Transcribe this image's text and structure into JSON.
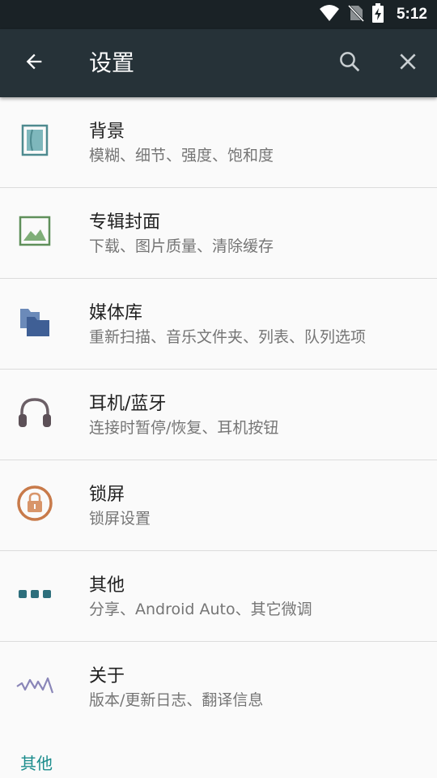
{
  "status_bar": {
    "time": "5:12",
    "icons": [
      "wifi-icon",
      "no-sim-icon",
      "battery-charging-icon"
    ]
  },
  "app_bar": {
    "title": "设置",
    "back_icon": "arrow-back-icon",
    "search_icon": "search-icon",
    "close_icon": "close-icon"
  },
  "settings": [
    {
      "title": "背景",
      "subtitle": "模糊、细节、强度、饱和度",
      "icon": "background-icon"
    },
    {
      "title": "专辑封面",
      "subtitle": "下载、图片质量、清除缓存",
      "icon": "image-icon"
    },
    {
      "title": "媒体库",
      "subtitle": "重新扫描、音乐文件夹、列表、队列选项",
      "icon": "folder-icon"
    },
    {
      "title": "耳机/蓝牙",
      "subtitle": "连接时暂停/恢复、耳机按钮",
      "icon": "headphones-icon"
    },
    {
      "title": "锁屏",
      "subtitle": "锁屏设置",
      "icon": "lock-icon"
    },
    {
      "title": "其他",
      "subtitle": "分享、Android Auto、其它微调",
      "icon": "more-dots-icon"
    },
    {
      "title": "关于",
      "subtitle": "版本/更新日志、翻译信息",
      "icon": "waveform-icon"
    }
  ],
  "section_header": "其他",
  "colors": {
    "appbar": "#263238",
    "statusbar": "#1a2226",
    "accent": "#1a8c8c"
  }
}
